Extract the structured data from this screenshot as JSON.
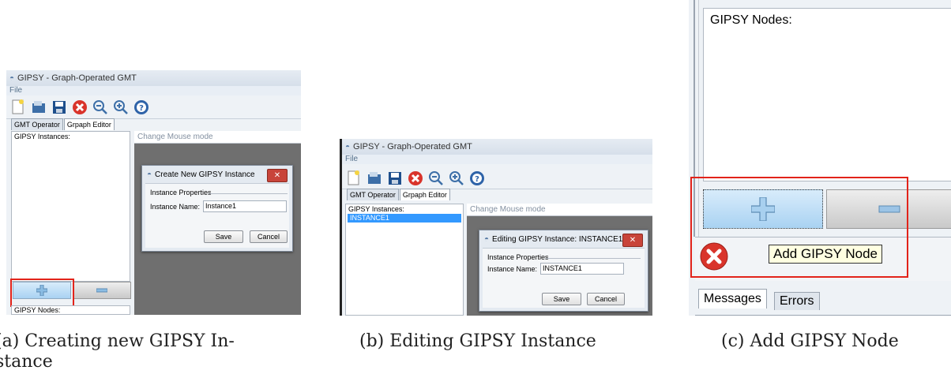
{
  "window": {
    "title": "GIPSY - Graph-Operated GMT",
    "menu_file": "File",
    "tabs": [
      "GMT Operator",
      "Grpaph Editor"
    ],
    "change_mouse_mode": "Change Mouse mode",
    "instances_label": "GIPSY Instances:",
    "nodes_label": "GIPSY Nodes:"
  },
  "toolbar_icons": [
    "new-file-icon",
    "open-folder-icon",
    "save-icon",
    "close-icon",
    "zoom-out-icon",
    "zoom-in-icon",
    "help-icon"
  ],
  "panel_a": {
    "dialog_title": "Create New GIPSY Instance",
    "section": "Instance Properties",
    "name_label": "Instance Name:",
    "name_value": "Instance1",
    "save": "Save",
    "cancel": "Cancel",
    "caption_line1": "(a) Creating new GIPSY In-",
    "caption_line2": "stance"
  },
  "panel_b": {
    "selected_instance": "INSTANCE1",
    "dialog_title": "Editing GIPSY Instance: INSTANCE1",
    "section": "Instance Properties",
    "name_label": "Instance Name:",
    "name_value": "INSTANCE1",
    "save": "Save",
    "cancel": "Cancel",
    "caption": "(b) Editing GIPSY Instance"
  },
  "panel_c": {
    "nodes_label": "GIPSY Nodes:",
    "tooltip": "Add GIPSY Node",
    "tab_messages": "Messages",
    "tab_errors": "Errors",
    "caption": "(c) Add GIPSY Node"
  },
  "colors": {
    "highlight_red": "#e2231a",
    "selection_blue": "#3399ff",
    "error_red": "#d9342b"
  }
}
